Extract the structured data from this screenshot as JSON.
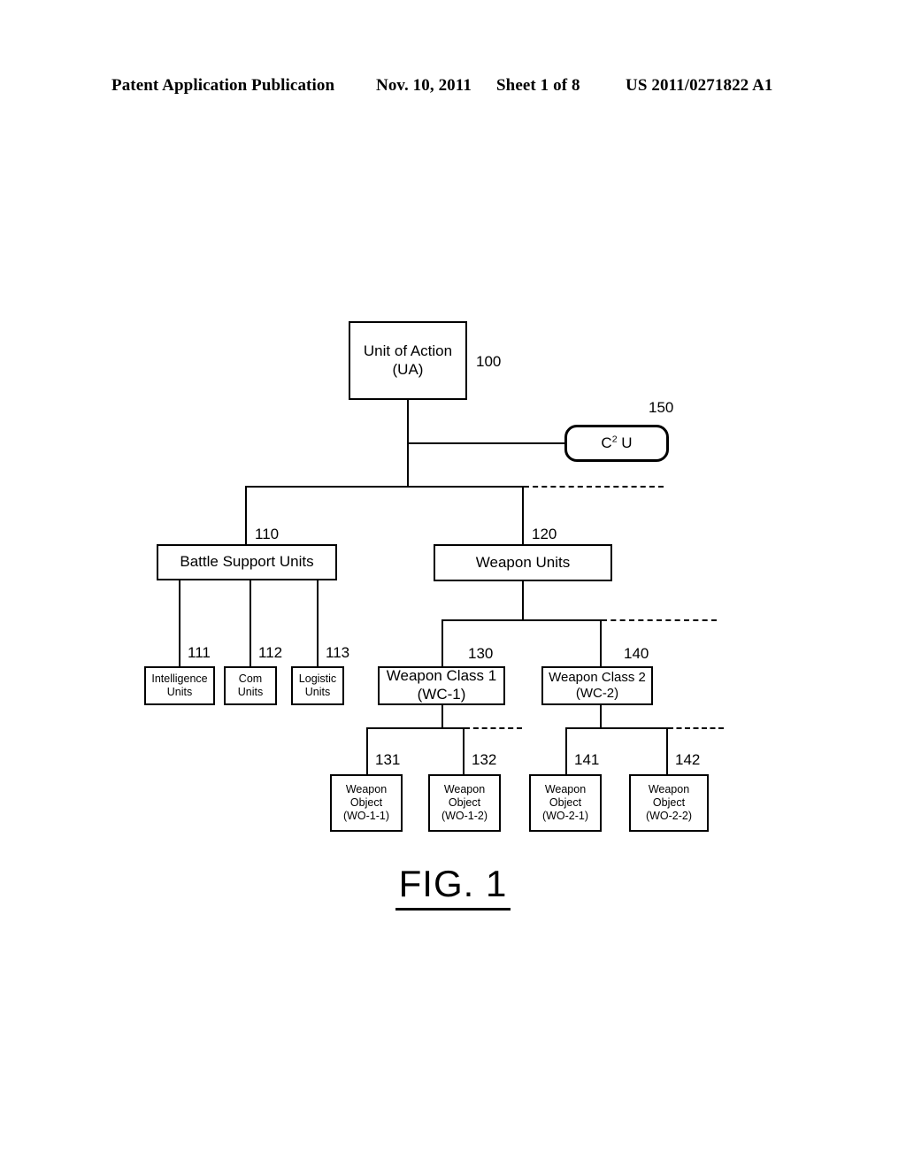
{
  "header": {
    "publication": "Patent Application Publication",
    "date": "Nov. 10, 2011",
    "sheet": "Sheet 1 of 8",
    "number": "US 2011/0271822 A1"
  },
  "figure": {
    "caption": "FIG. 1"
  },
  "nodes": {
    "ua": {
      "line1": "Unit of Action",
      "line2": "(UA)",
      "ref": "100"
    },
    "c2u": {
      "line1": "C",
      "sup": "2",
      "line2": " U",
      "ref": "150"
    },
    "bsu": {
      "line1": "Battle Support Units",
      "ref": "110"
    },
    "wu": {
      "line1": "Weapon Units",
      "ref": "120"
    },
    "iu": {
      "line1": "Intelligence",
      "line2": "Units",
      "ref": "111"
    },
    "cu": {
      "line1": "Com",
      "line2": "Units",
      "ref": "112"
    },
    "lu": {
      "line1": "Logistic",
      "line2": "Units",
      "ref": "113"
    },
    "wc1": {
      "line1": "Weapon Class 1",
      "line2": "(WC-1)",
      "ref": "130"
    },
    "wc2": {
      "line1": "Weapon Class 2",
      "line2": "(WC-2)",
      "ref": "140"
    },
    "wo11": {
      "line1": "Weapon",
      "line2": "Object",
      "line3": "(WO-1-1)",
      "ref": "131"
    },
    "wo12": {
      "line1": "Weapon",
      "line2": "Object",
      "line3": "(WO-1-2)",
      "ref": "132"
    },
    "wo21": {
      "line1": "Weapon",
      "line2": "Object",
      "line3": "(WO-2-1)",
      "ref": "141"
    },
    "wo22": {
      "line1": "Weapon",
      "line2": "Object",
      "line3": "(WO-2-2)",
      "ref": "142"
    }
  },
  "colors": {
    "ink": "#000000",
    "paper": "#ffffff"
  }
}
